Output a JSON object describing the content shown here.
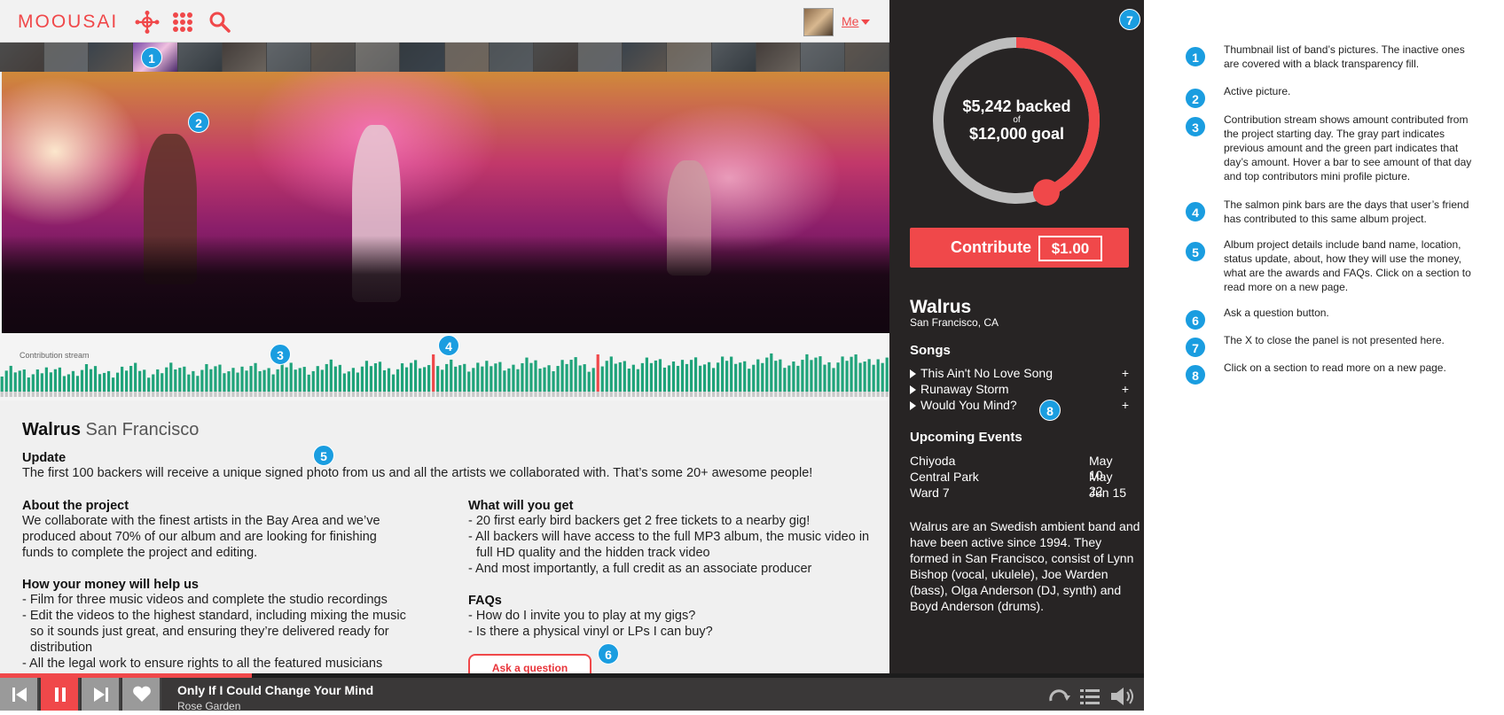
{
  "header": {
    "logo": "MOOUSAI",
    "me_label": "Me",
    "icons": [
      "network-icon",
      "grid-icon",
      "search-icon"
    ]
  },
  "stream": {
    "title": "Contribution stream"
  },
  "details": {
    "band_name": "Walrus",
    "band_city": "San Francisco",
    "update_heading": "Update",
    "update_text": "The first 100 backers will receive a unique signed photo from us and all the artists we collaborated with. That’s some 20+ awesome people!",
    "about_heading": "About the project",
    "about_lines": [
      "We collaborate with the finest artists in the Bay Area and we’ve",
      "produced about 70% of our album and are looking for finishing",
      "funds to complete the project and editing."
    ],
    "money_heading": "How your money will help us",
    "money_items": [
      "- Film for three music videos and complete the studio recordings",
      "- Edit the videos to the highest standard, including mixing the music so it sounds just great, and ensuring they’re delivered ready for distribution",
      "- All the legal work to ensure rights to all the featured musicians"
    ],
    "get_heading": "What will you get",
    "get_items": [
      "- 20 first early bird backers get 2 free tickets to a nearby gig!",
      "- All backers will have access to the full MP3 album, the music video in full HD quality and the hidden track video",
      "- And most importantly, a full credit as an associate producer"
    ],
    "faq_heading": "FAQs",
    "faq_items": [
      "- How do I invite you to play at my gigs?",
      "- Is there a physical vinyl or LPs I can buy?"
    ],
    "ask_button": "Ask a question"
  },
  "panel": {
    "backed_amount": "$5,242 backed",
    "backed_of": "of",
    "goal": "$12,000 goal",
    "progress_fraction": 0.437,
    "contribute_label": "Contribute",
    "contribute_amount": "$1.00",
    "band_name": "Walrus",
    "location": "San Francisco, CA",
    "songs_heading": "Songs",
    "songs": [
      "This Ain't No Love Song",
      "Runaway Storm",
      "Would You Mind?"
    ],
    "plus": "+",
    "events_heading": "Upcoming Events",
    "events": [
      {
        "place": "Chiyoda",
        "date": "May  10"
      },
      {
        "place": "Central Park",
        "date": "May  22"
      },
      {
        "place": "Ward 7",
        "date": "Jun   15"
      }
    ],
    "about": "Walrus are an Swedish ambient band and have been active since 1994. They formed in San Francisco, consist of Lynn Bishop (vocal, ukulele), Joe Warden (bass), Olga Anderson (DJ, synth) and Boyd Anderson (drums)."
  },
  "player": {
    "track": "Only If I Could Change Your Mind",
    "artist": "Rose Garden",
    "progress_fraction": 0.22
  },
  "badges": [
    "1",
    "2",
    "3",
    "4",
    "5",
    "6",
    "7",
    "8"
  ],
  "notes": [
    {
      "n": "1",
      "text": "Thumbnail list of band’s pictures. The inactive ones are covered with a black transparency fill."
    },
    {
      "n": "2",
      "text": "Active picture."
    },
    {
      "n": "3",
      "text": "Contribution stream shows amount contributed from the project starting day. The gray part indicates previous amount and the green part indicates that day’s amount. Hover a bar to see amount of that day and top contributors mini profile picture."
    },
    {
      "n": "4",
      "text": "The salmon pink bars are the days that user’s friend has contributed to this same album project."
    },
    {
      "n": "5",
      "text": "Album project details include band name, location, status update, about, how they will use the money, what are the awards and FAQs. Click on a section to read more on a new page."
    },
    {
      "n": "6",
      "text": "Ask a question button."
    },
    {
      "n": "7",
      "text": "The X to close the panel is not presented here."
    },
    {
      "n": "8",
      "text": "Click on a section to read more on a new page."
    }
  ],
  "colors": {
    "accent": "#f0484a",
    "stream_green": "#1fa37a",
    "stream_gray": "#c8c8c8",
    "panel_bg": "#272424",
    "badge": "#1a9de0"
  }
}
